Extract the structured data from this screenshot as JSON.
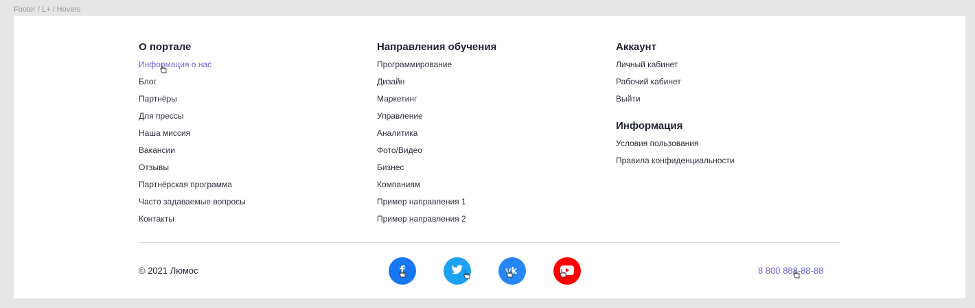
{
  "frame_label": "Footer / L+ / Hovers",
  "columns": [
    {
      "title": "О портале",
      "links": [
        "Информация о нас",
        "Блог",
        "Партнёры",
        "Для прессы",
        "Наша миссия",
        "Вакансии",
        "Отзывы",
        "Партнёрская программа",
        "Часто задаваемые вопросы",
        "Контакты"
      ]
    },
    {
      "title": "Направления обучения",
      "links": [
        "Программирование",
        "Дизайн",
        "Маркетинг",
        "Управление",
        "Аналитика",
        "Фото/Видео",
        "Бизнес",
        "Компаниям",
        "Пример направления 1",
        "Пример направления 2"
      ]
    },
    {
      "title": "Аккаунт",
      "links": [
        "Личный кабинет",
        "Рабочий кабинет",
        "Выйти"
      ]
    },
    {
      "title": "Информация",
      "links": [
        "Условия пользования",
        "Правила конфиденциальности"
      ]
    }
  ],
  "bottom": {
    "copyright": "© 2021 Люмос",
    "phone": "8 800 888-88-88"
  },
  "social": [
    {
      "name": "facebook",
      "icon": "facebook-icon",
      "color": "#1877f2"
    },
    {
      "name": "twitter",
      "icon": "twitter-icon",
      "color": "#1da1f2"
    },
    {
      "name": "vk",
      "icon": "vk-icon",
      "color": "#2787f5"
    },
    {
      "name": "youtube",
      "icon": "youtube-icon",
      "color": "#ff0000"
    }
  ],
  "colors": {
    "hover_link": "#6a63d6",
    "text": "#1f2330",
    "background": "#e5e5e5"
  }
}
